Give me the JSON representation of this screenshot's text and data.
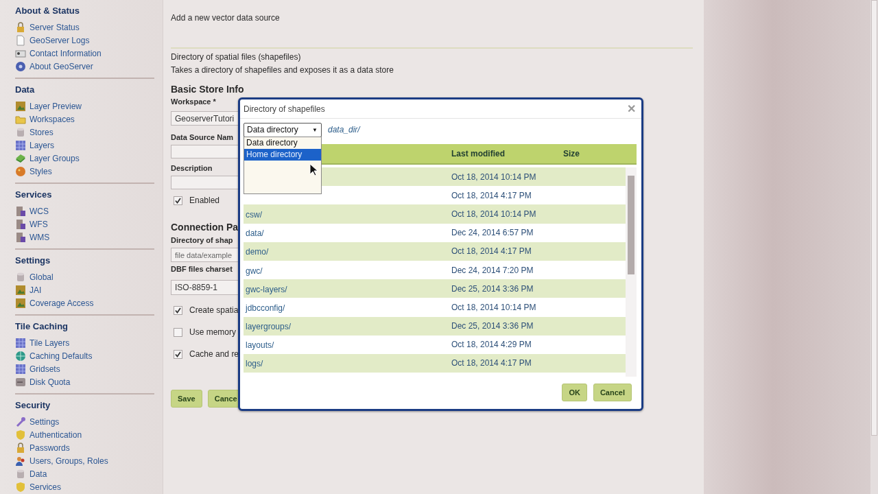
{
  "sidebar": {
    "sections": [
      {
        "title": "About & Status",
        "items": [
          "Server Status",
          "GeoServer Logs",
          "Contact Information",
          "About GeoServer"
        ]
      },
      {
        "title": "Data",
        "items": [
          "Layer Preview",
          "Workspaces",
          "Stores",
          "Layers",
          "Layer Groups",
          "Styles"
        ]
      },
      {
        "title": "Services",
        "items": [
          "WCS",
          "WFS",
          "WMS"
        ]
      },
      {
        "title": "Settings",
        "items": [
          "Global",
          "JAI",
          "Coverage Access"
        ]
      },
      {
        "title": "Tile Caching",
        "items": [
          "Tile Layers",
          "Caching Defaults",
          "Gridsets",
          "Disk Quota"
        ]
      },
      {
        "title": "Security",
        "items": [
          "Settings",
          "Authentication",
          "Passwords",
          "Users, Groups, Roles",
          "Data",
          "Services"
        ]
      }
    ]
  },
  "form": {
    "intro": "Add a new vector data source",
    "store_type": "Directory of spatial files (shapefiles)",
    "store_description": "Takes a directory of shapefiles and exposes it as a data store",
    "basic_title": "Basic Store Info",
    "workspace_label": "Workspace *",
    "workspace_value": "GeoserverTutori",
    "name_label": "Data Source Nam",
    "description_label": "Description",
    "enabled": {
      "label": "Enabled",
      "checked": true
    },
    "connection_title": "Connection Pa",
    "directory_label": "Directory of shap",
    "directory_value": "file data/example",
    "charset_label": "DBF files charset",
    "charset_value": "ISO-8859-1",
    "options": [
      {
        "label": "Create spatia",
        "checked": true
      },
      {
        "label": "Use memory",
        "checked": false
      },
      {
        "label": "Cache and re",
        "checked": true
      }
    ],
    "buttons": [
      "Save",
      "Cance"
    ]
  },
  "dialog": {
    "title": "Directory of shapefiles",
    "close": "✕",
    "root_select": {
      "value": "Data directory",
      "arrow": "▼",
      "options": [
        {
          "label": "Data directory",
          "highlighted": false
        },
        {
          "label": "Home directory",
          "highlighted": true
        }
      ]
    },
    "path": "data_dir/",
    "columns": [
      "Last modified",
      "Size"
    ],
    "rows": [
      {
        "modified": "Oct 18, 2014 10:14 PM"
      },
      {
        "modified": "Oct 18, 2014 4:17 PM"
      },
      {
        "name": "csw/",
        "modified": "Oct 18, 2014 10:14 PM"
      },
      {
        "name": "data/",
        "modified": "Dec 24, 2014 6:57 PM"
      },
      {
        "name": "demo/",
        "modified": "Oct 18, 2014 4:17 PM"
      },
      {
        "name": "gwc/",
        "modified": "Dec 24, 2014 7:20 PM"
      },
      {
        "name": "gwc-layers/",
        "modified": "Dec 25, 2014 3:36 PM"
      },
      {
        "name": "jdbcconfig/",
        "modified": "Oct 18, 2014 10:14 PM"
      },
      {
        "name": "layergroups/",
        "modified": "Dec 25, 2014 3:36 PM"
      },
      {
        "name": "layouts/",
        "modified": "Oct 18, 2014 4:29 PM"
      },
      {
        "name": "logs/",
        "modified": "Oct 18, 2014 4:17 PM"
      }
    ],
    "buttons": [
      "OK",
      "Cancel"
    ]
  }
}
